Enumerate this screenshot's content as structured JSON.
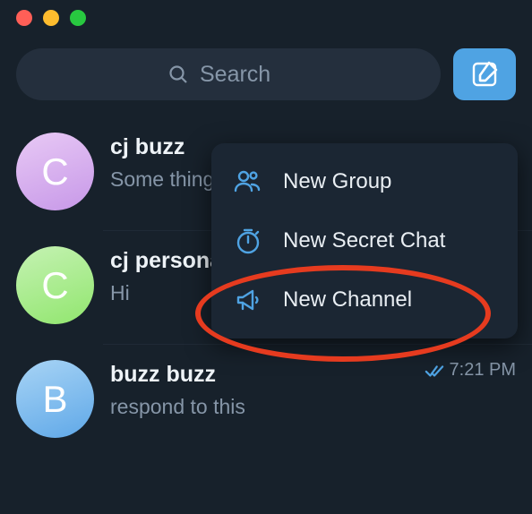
{
  "search": {
    "placeholder": "Search"
  },
  "chats": [
    {
      "title": "cj buzz",
      "preview": "Some thing about home",
      "avatar_letter": "C",
      "avatar_class": "av-purple",
      "time": "",
      "read": false
    },
    {
      "title": "cj personal",
      "preview": "Hi",
      "avatar_letter": "C",
      "avatar_class": "av-green",
      "time": "",
      "read": false
    },
    {
      "title": "buzz buzz",
      "preview": "respond to this",
      "avatar_letter": "B",
      "avatar_class": "av-blue",
      "time": "7:21 PM",
      "read": true
    }
  ],
  "popup": {
    "items": [
      {
        "label": "New Group",
        "icon": "group-icon"
      },
      {
        "label": "New Secret Chat",
        "icon": "timer-icon"
      },
      {
        "label": "New Channel",
        "icon": "megaphone-icon"
      }
    ]
  },
  "highlight_target": "new-channel-item"
}
